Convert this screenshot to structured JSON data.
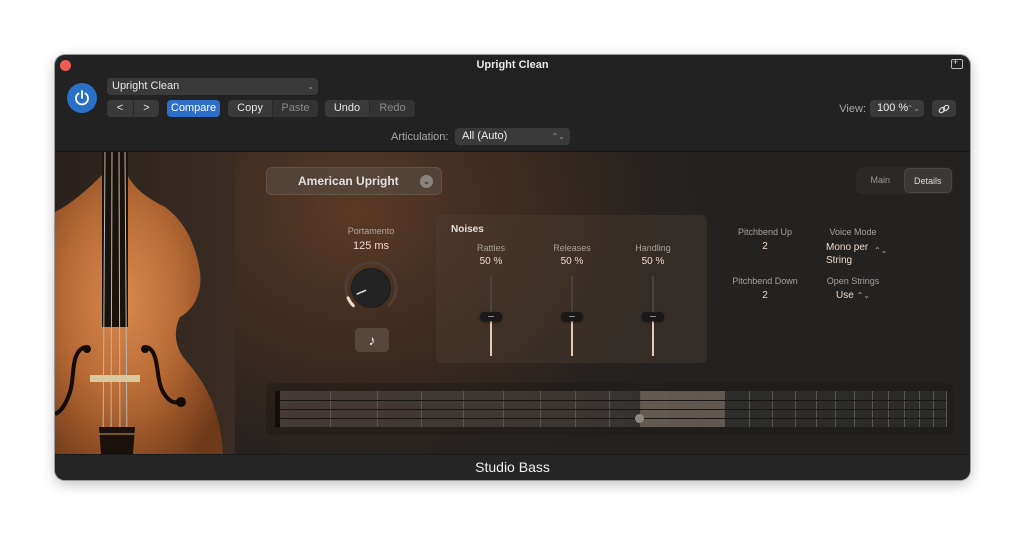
{
  "window": {
    "title": "Upright Clean",
    "footer_title": "Studio Bass"
  },
  "toolbar": {
    "preset": "Upright Clean",
    "prev_label": "<",
    "next_label": ">",
    "compare_label": "Compare",
    "copy_label": "Copy",
    "paste_label": "Paste",
    "undo_label": "Undo",
    "redo_label": "Redo",
    "view_label": "View:",
    "view_value": "100 %",
    "articulation_label": "Articulation:",
    "articulation_value": "All (Auto)"
  },
  "plugin": {
    "patch": "American Upright",
    "tabs": [
      {
        "label": "Main",
        "active": false
      },
      {
        "label": "Details",
        "active": true
      }
    ],
    "portamento": {
      "label": "Portamento",
      "value": "125 ms",
      "knob_fraction": 0.08
    },
    "note_button_glyph": "♪",
    "noises": {
      "title": "Noises",
      "faders": [
        {
          "label": "Rattles",
          "value": "50 %",
          "fraction": 0.5
        },
        {
          "label": "Releases",
          "value": "50 %",
          "fraction": 0.5
        },
        {
          "label": "Handling",
          "value": "50 %",
          "fraction": 0.5
        }
      ]
    },
    "pitchbend_up": {
      "label": "Pitchbend Up",
      "value": "2"
    },
    "pitchbend_down": {
      "label": "Pitchbend Down",
      "value": "2"
    },
    "voice_mode": {
      "label": "Voice Mode",
      "value_line1": "Mono per",
      "value_line2": "String"
    },
    "open_strings": {
      "label": "Open Strings",
      "value": "Use"
    },
    "fretboard": {
      "strings": 4,
      "frets": 24,
      "highlight_frets": [
        9,
        12
      ],
      "marker": {
        "fret": 9,
        "string": 3
      }
    }
  },
  "colors": {
    "accent": "#2d6ecb",
    "power": "#2a6fc8",
    "value_text": "#f0d8c8",
    "close": "#ee5b52"
  }
}
